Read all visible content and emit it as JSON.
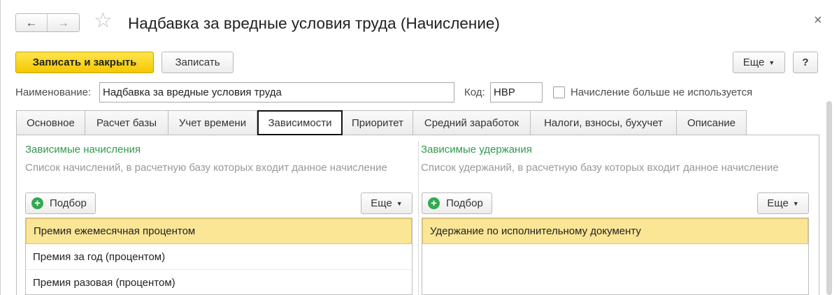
{
  "window": {
    "title": "Надбавка за вредные условия труда (Начисление)",
    "back_icon": "←",
    "forward_icon": "→",
    "star_icon": "☆",
    "close_icon": "×"
  },
  "toolbar": {
    "save_close_label": "Записать и закрыть",
    "save_label": "Записать",
    "more_label": "Еще",
    "help_label": "?"
  },
  "form": {
    "name_label": "Наименование:",
    "name_value": "Надбавка за вредные условия труда",
    "code_label": "Код:",
    "code_value": "НВР",
    "not_used_label": "Начисление больше не используется",
    "not_used_checked": false
  },
  "tabs": [
    {
      "label": "Основное",
      "active": false
    },
    {
      "label": "Расчет базы",
      "active": false
    },
    {
      "label": "Учет времени",
      "active": false
    },
    {
      "label": "Зависимости",
      "active": true
    },
    {
      "label": "Приоритет",
      "active": false
    },
    {
      "label": "Средний заработок",
      "active": false
    },
    {
      "label": "Налоги, взносы, бухучет",
      "active": false
    },
    {
      "label": "Описание",
      "active": false
    }
  ],
  "left_section": {
    "title": "Зависимые начисления",
    "description": "Список начислений, в расчетную базу которых входит данное начисление",
    "pick_label": "Подбор",
    "more_label": "Еще",
    "items": [
      {
        "label": "Премия ежемесячная процентом",
        "selected": true
      },
      {
        "label": "Премия за год (процентом)",
        "selected": false
      },
      {
        "label": "Премия разовая (процентом)",
        "selected": false
      }
    ]
  },
  "right_section": {
    "title": "Зависимые удержания",
    "description": "Список удержаний, в расчетную базу которых входит данное начисление",
    "pick_label": "Подбор",
    "more_label": "Еще",
    "items": [
      {
        "label": "Удержание по исполнительному документу",
        "selected": true
      }
    ]
  },
  "colors": {
    "primary_button": "#f4c800",
    "section_title": "#2f9a4e",
    "selected_row": "#fbe696"
  }
}
